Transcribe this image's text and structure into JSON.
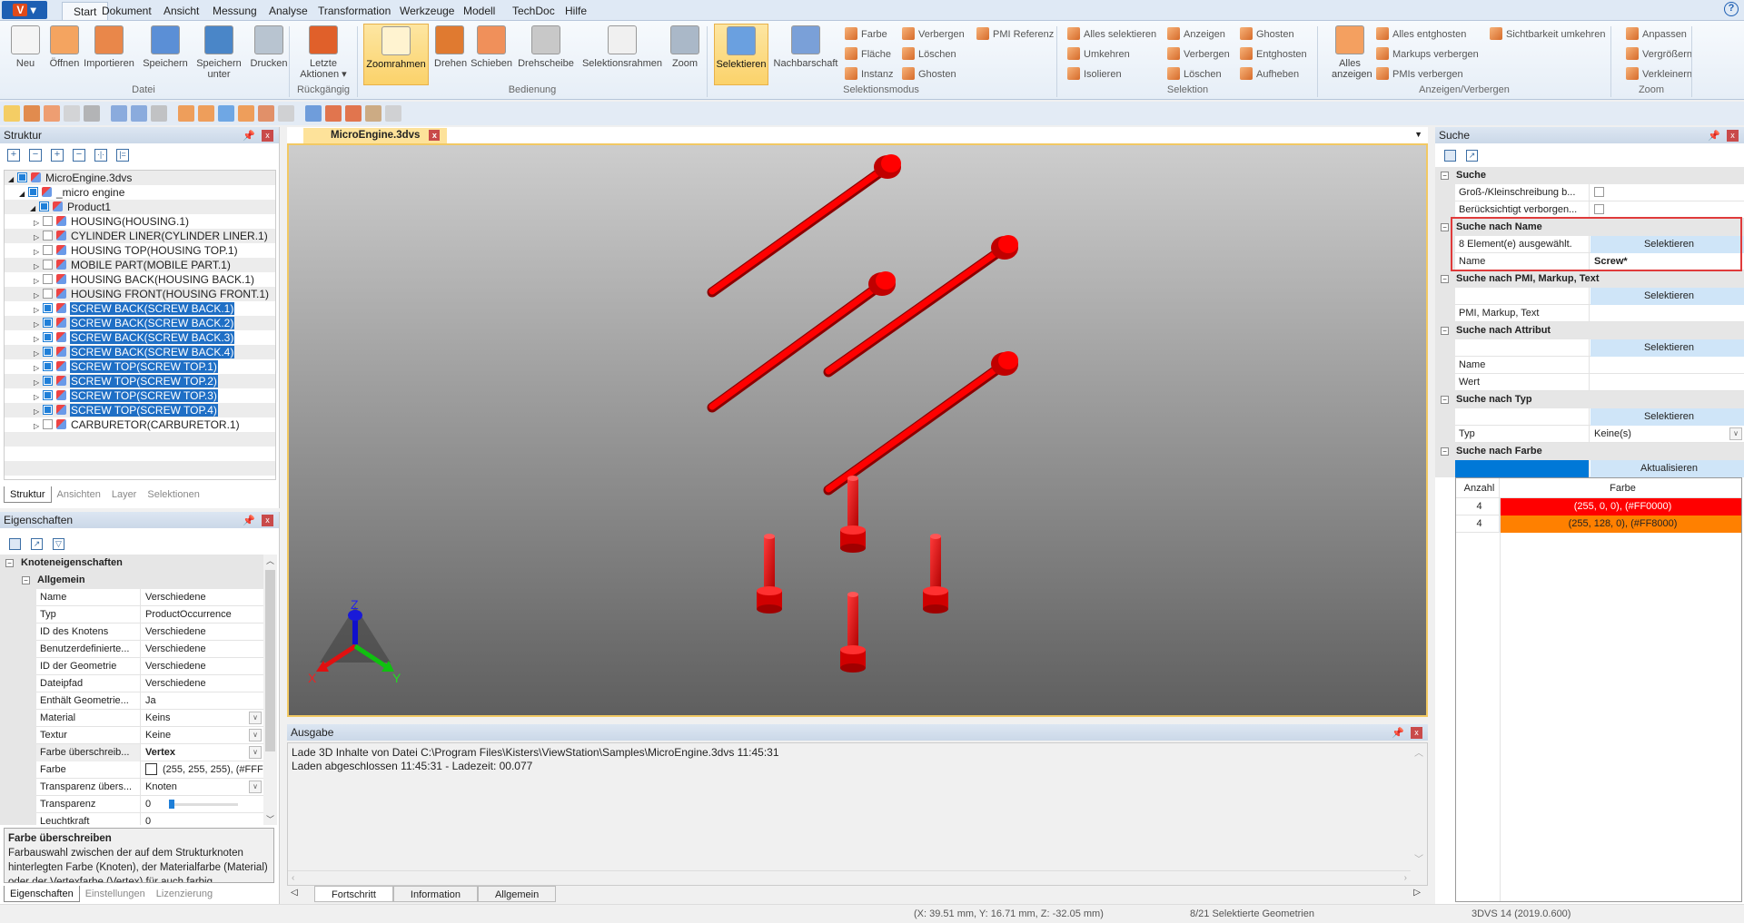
{
  "app": {
    "menu_label": "V",
    "help_icon": "help-icon"
  },
  "ribbon": {
    "tabs": [
      "Start",
      "Dokument",
      "Ansicht",
      "Messung",
      "Analyse",
      "Transformation",
      "Werkzeuge",
      "Modell",
      "TechDoc",
      "Hilfe"
    ],
    "active_tab": "Start",
    "groups": {
      "datei": "Datei",
      "rueck": "Rückgängig",
      "bedienung": "Bedienung",
      "selmodus": "Selektionsmodus",
      "selektion": "Selektion",
      "anzeigen": "Anzeigen/Verbergen",
      "zoom": "Zoom"
    },
    "big": [
      {
        "label": "Neu",
        "icon": "new-document-icon"
      },
      {
        "label": "Öffnen",
        "icon": "open-folder-icon"
      },
      {
        "label": "Importieren",
        "icon": "import-icon"
      },
      {
        "label": "Speichern",
        "icon": "save-icon"
      },
      {
        "label": "Speichern unter",
        "icon": "save-as-icon"
      },
      {
        "label": "Drucken",
        "icon": "print-icon"
      },
      {
        "label": "Letzte Aktionen ▾",
        "icon": "undo-icon"
      },
      {
        "label": "Zoomrahmen",
        "icon": "zoom-frame-icon",
        "active": true
      },
      {
        "label": "Drehen",
        "icon": "rotate-icon"
      },
      {
        "label": "Schieben",
        "icon": "pan-icon"
      },
      {
        "label": "Drehscheibe",
        "icon": "turntable-icon"
      },
      {
        "label": "Selektionsrahmen",
        "icon": "selection-frame-icon"
      },
      {
        "label": "Zoom",
        "icon": "zoom-icon"
      },
      {
        "label": "Selektieren",
        "icon": "select-icon",
        "active": true
      },
      {
        "label": "Nachbarschaft",
        "icon": "neighborhood-icon"
      },
      {
        "label": "Alles anzeigen",
        "icon": "show-all-icon"
      }
    ],
    "small": [
      "Farbe",
      "Fläche",
      "Instanz",
      "Verbergen",
      "Löschen",
      "Ghosten",
      "PMI Referenz",
      "Alles selektieren",
      "Umkehren",
      "Isolieren",
      "Anzeigen",
      "Verbergen",
      "Löschen",
      "Ghosten",
      "Entghosten",
      "Aufheben",
      "Alles entghosten",
      "Markups verbergen",
      "PMIs verbergen",
      "Sichtbarkeit umkehren",
      "Anpassen",
      "Vergrößern",
      "Verkleinern"
    ]
  },
  "structure": {
    "title": "Struktur",
    "rows": [
      {
        "label": "MicroEngine.3dvs",
        "level": 0,
        "checked": true
      },
      {
        "label": "_micro engine",
        "level": 1,
        "checked": true
      },
      {
        "label": "Product1",
        "level": 2,
        "checked": true
      },
      {
        "label": "HOUSING(HOUSING.1)",
        "level": 3,
        "checked": false
      },
      {
        "label": "CYLINDER LINER(CYLINDER LINER.1)",
        "level": 3,
        "checked": false
      },
      {
        "label": "HOUSING TOP(HOUSING TOP.1)",
        "level": 3,
        "checked": false
      },
      {
        "label": "MOBILE PART(MOBILE PART.1)",
        "level": 3,
        "checked": false
      },
      {
        "label": "HOUSING BACK(HOUSING BACK.1)",
        "level": 3,
        "checked": false
      },
      {
        "label": "HOUSING FRONT(HOUSING FRONT.1)",
        "level": 3,
        "checked": false
      },
      {
        "label": "SCREW BACK(SCREW BACK.1)",
        "level": 3,
        "checked": true,
        "selected": true
      },
      {
        "label": "SCREW BACK(SCREW BACK.2)",
        "level": 3,
        "checked": true,
        "selected": true
      },
      {
        "label": "SCREW BACK(SCREW BACK.3)",
        "level": 3,
        "checked": true,
        "selected": true
      },
      {
        "label": "SCREW BACK(SCREW BACK.4)",
        "level": 3,
        "checked": true,
        "selected": true
      },
      {
        "label": "SCREW TOP(SCREW TOP.1)",
        "level": 3,
        "checked": true,
        "selected": true
      },
      {
        "label": "SCREW TOP(SCREW TOP.2)",
        "level": 3,
        "checked": true,
        "selected": true
      },
      {
        "label": "SCREW TOP(SCREW TOP.3)",
        "level": 3,
        "checked": true,
        "selected": true
      },
      {
        "label": "SCREW TOP(SCREW TOP.4)",
        "level": 3,
        "checked": true,
        "selected": true
      },
      {
        "label": "CARBURETOR(CARBURETOR.1)",
        "level": 3,
        "checked": false
      }
    ],
    "tabs": [
      "Struktur",
      "Ansichten",
      "Layer",
      "Selektionen"
    ]
  },
  "properties": {
    "title": "Eigenschaften",
    "group": "Knoteneigenschaften",
    "subgroup": "Allgemein",
    "rows": [
      {
        "name": "Name",
        "value": "Verschiedene"
      },
      {
        "name": "Typ",
        "value": "ProductOccurrence"
      },
      {
        "name": "ID des Knotens",
        "value": "Verschiedene"
      },
      {
        "name": "Benutzerdefinierte...",
        "value": "Verschiedene"
      },
      {
        "name": "ID der Geometrie",
        "value": "Verschiedene"
      },
      {
        "name": "Dateipfad",
        "value": "Verschiedene"
      },
      {
        "name": "Enthält Geometrie...",
        "value": "Ja"
      },
      {
        "name": "Material",
        "value": "Keins",
        "dropdown": true
      },
      {
        "name": "Textur",
        "value": "Keine",
        "dropdown": true
      },
      {
        "name": "Farbe überschreib...",
        "value": "Vertex",
        "dropdown": true,
        "bold": true
      },
      {
        "name": "Farbe",
        "value": "(255, 255, 255), (#FFFFFF)",
        "swatch": "#FFFFFF"
      },
      {
        "name": "Transparenz übers...",
        "value": "Knoten",
        "dropdown": true
      },
      {
        "name": "Transparenz",
        "value": "0",
        "slider": 0
      },
      {
        "name": "Leuchtkraft",
        "value": "0"
      }
    ],
    "desc_title": "Farbe überschreiben",
    "desc_text": "Farbauswahl zwischen der auf dem Strukturknoten hinterlegten Farbe (Knoten), der Materialfarbe (Material) oder der Vertexfarbe (Vertex) für auch farbig",
    "tabs": [
      "Eigenschaften",
      "Einstellungen",
      "Lizenzierung"
    ]
  },
  "viewport": {
    "tab": "MicroEngine.3dvs",
    "axes": [
      "X",
      "Y",
      "Z"
    ],
    "part_color": "#FF0000"
  },
  "output": {
    "title": "Ausgabe",
    "lines": [
      "Lade 3D Inhalte von Datei C:\\Program Files\\Kisters\\ViewStation\\Samples\\MicroEngine.3dvs 11:45:31",
      "Laden abgeschlossen 11:45:31 - Ladezeit: 00.077"
    ],
    "tabs": [
      "Fortschritt",
      "Information",
      "Allgemein"
    ]
  },
  "search": {
    "title": "Suche",
    "g1": "Suche",
    "case": "Groß-/Kleinschreibung b...",
    "hidden": "Berücksichtigt verborgen...",
    "g2": "Suche nach Name",
    "count": "8 Element(e) ausgewählt.",
    "select": "Selektieren",
    "name_label": "Name",
    "name_value": "Screw*",
    "g3": "Suche nach PMI, Markup, Text",
    "pmi_label": "PMI, Markup, Text",
    "g4": "Suche nach Attribut",
    "attr_name": "Name",
    "attr_value": "Wert",
    "g5": "Suche nach Typ",
    "type_label": "Typ",
    "type_value": "Keine(s)",
    "g6": "Suche nach Farbe",
    "update": "Aktualisieren",
    "selected_color": "#0078D7",
    "table": {
      "headers": [
        "Anzahl",
        "Farbe"
      ],
      "rows": [
        {
          "count": "4",
          "color": "(255, 0, 0), (#FF0000)",
          "hex": "#FF0000"
        },
        {
          "count": "4",
          "color": "(255, 128, 0), (#FF8000)",
          "hex": "#FF8000"
        }
      ]
    }
  },
  "status": {
    "coords": "(X: 39.51 mm, Y: 16.71 mm, Z: -32.05 mm)",
    "selection": "8/21 Selektierte Geometrien",
    "version": "3DVS 14 (2019.0.600)"
  }
}
